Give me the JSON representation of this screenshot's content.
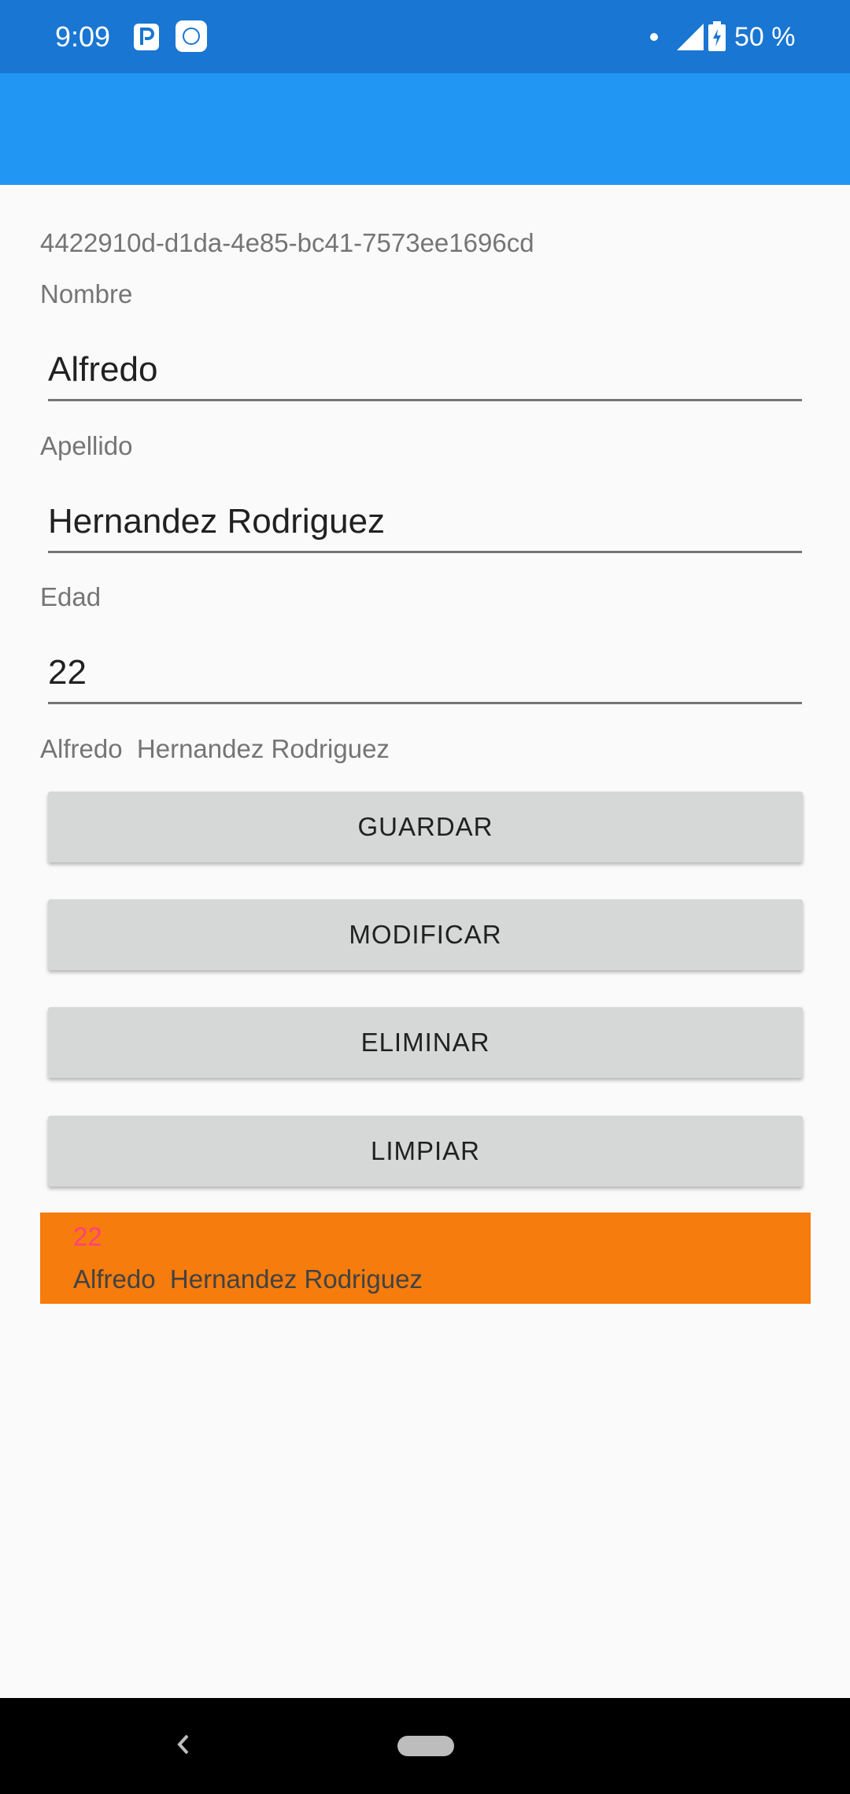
{
  "status_bar": {
    "time": "9:09",
    "battery": "50 %",
    "icons": [
      "p-app-icon",
      "app-notification-icon",
      "notification-dot-icon",
      "signal-icon",
      "battery-charging-icon"
    ]
  },
  "form": {
    "id": "4422910d-d1da-4e85-bc41-7573ee1696cd",
    "nombre_label": "Nombre",
    "nombre_value": "Alfredo",
    "apellido_label": "Apellido",
    "apellido_value": "Hernandez Rodriguez",
    "edad_label": "Edad",
    "edad_value": "22",
    "full_name": "Alfredo  Hernandez Rodriguez"
  },
  "buttons": {
    "guardar": "GUARDAR",
    "modificar": "MODIFICAR",
    "eliminar": "ELIMINAR",
    "limpiar": "LIMPIAR"
  },
  "list": {
    "items": [
      {
        "age": "22",
        "name": "Alfredo  Hernandez Rodriguez"
      }
    ]
  },
  "colors": {
    "status_bar": "#1976d2",
    "app_bar": "#2196f3",
    "list_item_bg": "#f57c0d",
    "list_age_text": "#ff4081",
    "button_bg": "#d6d7d7"
  }
}
